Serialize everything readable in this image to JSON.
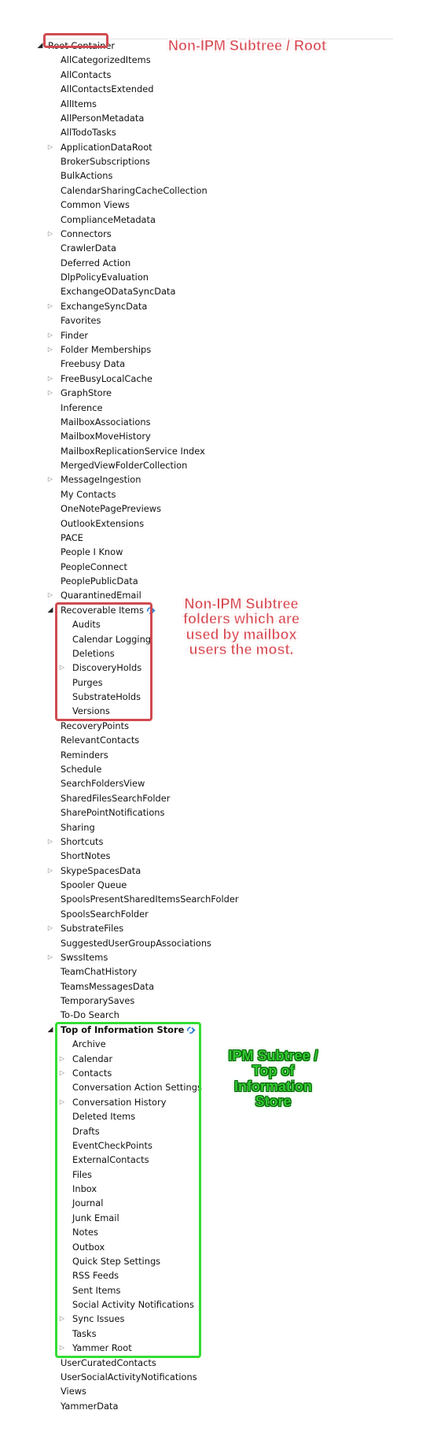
{
  "tree": {
    "root": {
      "label": "Root Container",
      "expanded": true
    },
    "root_children": [
      {
        "label": "AllCategorizedItems",
        "has_children": false
      },
      {
        "label": "AllContacts",
        "has_children": false
      },
      {
        "label": "AllContactsExtended",
        "has_children": false
      },
      {
        "label": "AllItems",
        "has_children": false
      },
      {
        "label": "AllPersonMetadata",
        "has_children": false
      },
      {
        "label": "AllTodoTasks",
        "has_children": false
      },
      {
        "label": "ApplicationDataRoot",
        "has_children": true
      },
      {
        "label": "BrokerSubscriptions",
        "has_children": false
      },
      {
        "label": "BulkActions",
        "has_children": false
      },
      {
        "label": "CalendarSharingCacheCollection",
        "has_children": false
      },
      {
        "label": "Common Views",
        "has_children": false
      },
      {
        "label": "ComplianceMetadata",
        "has_children": false
      },
      {
        "label": "Connectors",
        "has_children": true
      },
      {
        "label": "CrawlerData",
        "has_children": false
      },
      {
        "label": "Deferred Action",
        "has_children": false
      },
      {
        "label": "DlpPolicyEvaluation",
        "has_children": false
      },
      {
        "label": "ExchangeODataSyncData",
        "has_children": false
      },
      {
        "label": "ExchangeSyncData",
        "has_children": true
      },
      {
        "label": "Favorites",
        "has_children": false
      },
      {
        "label": "Finder",
        "has_children": true
      },
      {
        "label": "Folder Memberships",
        "has_children": true
      },
      {
        "label": "Freebusy Data",
        "has_children": false
      },
      {
        "label": "FreeBusyLocalCache",
        "has_children": true
      },
      {
        "label": "GraphStore",
        "has_children": true
      },
      {
        "label": "Inference",
        "has_children": false
      },
      {
        "label": "MailboxAssociations",
        "has_children": false
      },
      {
        "label": "MailboxMoveHistory",
        "has_children": false
      },
      {
        "label": "MailboxReplicationService Index",
        "has_children": false
      },
      {
        "label": "MergedViewFolderCollection",
        "has_children": false
      },
      {
        "label": "MessageIngestion",
        "has_children": true
      },
      {
        "label": "My Contacts",
        "has_children": false
      },
      {
        "label": "OneNotePagePreviews",
        "has_children": false
      },
      {
        "label": "OutlookExtensions",
        "has_children": false
      },
      {
        "label": "PACE",
        "has_children": false
      },
      {
        "label": "People I Know",
        "has_children": false
      },
      {
        "label": "PeopleConnect",
        "has_children": false
      },
      {
        "label": "PeoplePublicData",
        "has_children": false
      },
      {
        "label": "QuarantinedEmail",
        "has_children": true
      },
      {
        "label": "Recoverable Items",
        "has_children": true,
        "expanded": true,
        "sync_icon": true,
        "highlight": "red",
        "children": [
          {
            "label": "Audits",
            "has_children": false
          },
          {
            "label": "Calendar Logging",
            "has_children": false
          },
          {
            "label": "Deletions",
            "has_children": false
          },
          {
            "label": "DiscoveryHolds",
            "has_children": true
          },
          {
            "label": "Purges",
            "has_children": false
          },
          {
            "label": "SubstrateHolds",
            "has_children": false
          },
          {
            "label": "Versions",
            "has_children": false
          }
        ]
      },
      {
        "label": "RecoveryPoints",
        "has_children": false
      },
      {
        "label": "RelevantContacts",
        "has_children": false
      },
      {
        "label": "Reminders",
        "has_children": false
      },
      {
        "label": "Schedule",
        "has_children": false
      },
      {
        "label": "SearchFoldersView",
        "has_children": false
      },
      {
        "label": "SharedFilesSearchFolder",
        "has_children": false
      },
      {
        "label": "SharePointNotifications",
        "has_children": false
      },
      {
        "label": "Sharing",
        "has_children": false
      },
      {
        "label": "Shortcuts",
        "has_children": true
      },
      {
        "label": "ShortNotes",
        "has_children": false
      },
      {
        "label": "SkypeSpacesData",
        "has_children": true
      },
      {
        "label": "Spooler Queue",
        "has_children": false
      },
      {
        "label": "SpoolsPresentSharedItemsSearchFolder",
        "has_children": false
      },
      {
        "label": "SpoolsSearchFolder",
        "has_children": false
      },
      {
        "label": "SubstrateFiles",
        "has_children": true
      },
      {
        "label": "SuggestedUserGroupAssociations",
        "has_children": false
      },
      {
        "label": "SwssItems",
        "has_children": true
      },
      {
        "label": "TeamChatHistory",
        "has_children": false
      },
      {
        "label": "TeamsMessagesData",
        "has_children": false
      },
      {
        "label": "TemporarySaves",
        "has_children": false
      },
      {
        "label": "To-Do Search",
        "has_children": false
      },
      {
        "label": "Top of Information Store",
        "has_children": true,
        "expanded": true,
        "bold": true,
        "sync_icon": true,
        "highlight": "green",
        "children": [
          {
            "label": "Archive",
            "has_children": false
          },
          {
            "label": "Calendar",
            "has_children": true
          },
          {
            "label": "Contacts",
            "has_children": true
          },
          {
            "label": "Conversation Action Settings",
            "has_children": false
          },
          {
            "label": "Conversation History",
            "has_children": true
          },
          {
            "label": "Deleted Items",
            "has_children": false
          },
          {
            "label": "Drafts",
            "has_children": false
          },
          {
            "label": "EventCheckPoints",
            "has_children": false
          },
          {
            "label": "ExternalContacts",
            "has_children": false
          },
          {
            "label": "Files",
            "has_children": false
          },
          {
            "label": "Inbox",
            "has_children": false
          },
          {
            "label": "Journal",
            "has_children": false
          },
          {
            "label": "Junk Email",
            "has_children": false
          },
          {
            "label": "Notes",
            "has_children": false
          },
          {
            "label": "Outbox",
            "has_children": false
          },
          {
            "label": "Quick Step Settings",
            "has_children": false
          },
          {
            "label": "RSS Feeds",
            "has_children": false
          },
          {
            "label": "Sent Items",
            "has_children": false
          },
          {
            "label": "Social Activity Notifications",
            "has_children": false
          },
          {
            "label": "Sync Issues",
            "has_children": true
          },
          {
            "label": "Tasks",
            "has_children": false
          },
          {
            "label": "Yammer Root",
            "has_children": true
          }
        ]
      },
      {
        "label": "UserCuratedContacts",
        "has_children": false
      },
      {
        "label": "UserSocialActivityNotifications",
        "has_children": false
      },
      {
        "label": "Views",
        "has_children": false
      },
      {
        "label": "YammerData",
        "has_children": false
      }
    ]
  },
  "annotations": {
    "root_note": "Non-IPM Subtree / Root",
    "recoverable_note": [
      "Non-IPM Subtree",
      "folders which are",
      "used by mailbox",
      "users the most."
    ],
    "ipm_note": [
      "IPM Subtree /",
      "Top of",
      "Information",
      "Store"
    ]
  },
  "colors": {
    "red_highlight": "#d04a50",
    "green_highlight": "#33dd33",
    "sync_icon": "#2a7fd4"
  }
}
